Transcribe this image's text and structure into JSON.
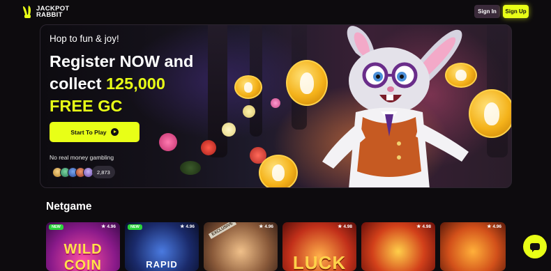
{
  "header": {
    "logo_line1": "JACKPOT",
    "logo_line2": "RABBIT",
    "signin_label": "Sign In",
    "signup_label": "Sign Up"
  },
  "hero": {
    "subtitle": "Hop to fun & joy!",
    "title_line1": "Register NOW and",
    "title_line2_prefix": "collect ",
    "title_line2_highlight": "125,000",
    "title_line3": "FREE GC",
    "cta_label": "Start To Play",
    "disclaimer": "No real money gambling",
    "players_count": "2,873"
  },
  "section": {
    "title": "Netgame"
  },
  "games": [
    {
      "rating": "4.96",
      "is_new": true,
      "title": "WILD COIN"
    },
    {
      "rating": "4.96",
      "is_new": true,
      "title": "RAPID"
    },
    {
      "rating": "4.96",
      "is_new": false,
      "title": "EXCLUSIVE"
    },
    {
      "rating": "4.98",
      "is_new": false,
      "title": "LUCK"
    },
    {
      "rating": "4.98",
      "is_new": false,
      "title": ""
    },
    {
      "rating": "4.96",
      "is_new": false,
      "title": ""
    }
  ],
  "new_badge_label": "NEW",
  "colors": {
    "accent": "#e8ff17",
    "background": "#0d0b0e",
    "new_badge": "#2bd43c"
  }
}
